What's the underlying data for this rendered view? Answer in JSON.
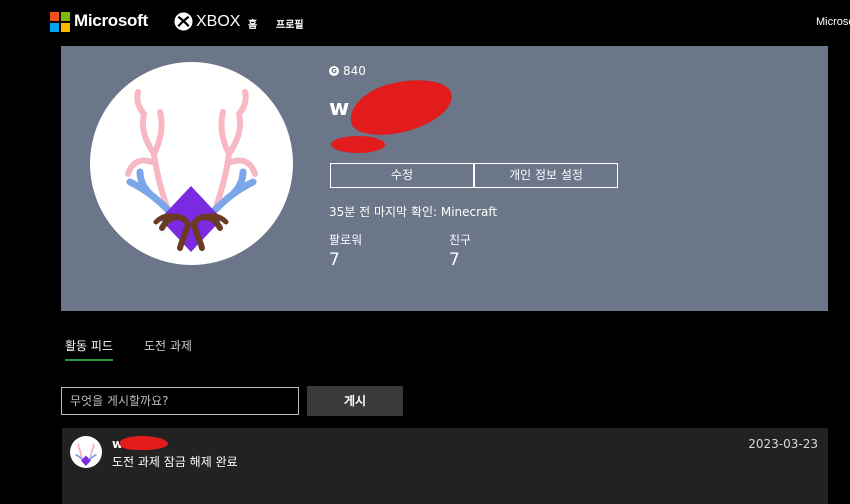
{
  "header": {
    "brand": "Microsoft",
    "xbox": "XBOX",
    "nav": {
      "home": "홈",
      "profile": "프로필"
    },
    "account_text": "Microsoft",
    "colors": {
      "red": "#f25022",
      "green": "#7fba00",
      "blue": "#00a4ef",
      "yellow": "#ffb900"
    }
  },
  "profile": {
    "gamerscore": "840",
    "gamertag": "w",
    "edit_label": "수정",
    "privacy_label": "개인 정보 설정",
    "last_seen": "35분 전 마지막 확인: Minecraft",
    "followers_label": "팔로워",
    "followers_count": "7",
    "friends_label": "친구",
    "friends_count": "7",
    "panel_color": "#6b7689"
  },
  "tabs": {
    "feed": "활동 피드",
    "challenges": "도전 과제"
  },
  "composer": {
    "placeholder": "무엇을 게시할까요?",
    "post_label": "게시"
  },
  "feed": [
    {
      "user": "w",
      "text": "도전 과제 잠금 해제 완료",
      "date": "2023-03-23"
    }
  ]
}
